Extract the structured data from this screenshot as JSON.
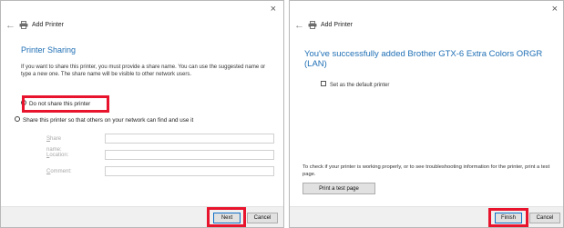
{
  "wizard1": {
    "close_glyph": "×",
    "back_glyph": "←",
    "header_title": "Add Printer",
    "page_title": "Printer Sharing",
    "description": "If you want to share this printer, you must provide a share name. You can use the suggested name or type a new one. The share name will be visible to other network users.",
    "options": [
      {
        "label": "Do not share this printer",
        "selected": true
      },
      {
        "label": "Share this printer so that others on your network can find and use it",
        "selected": false
      }
    ],
    "fields": [
      {
        "label": "Share name:",
        "value": ""
      },
      {
        "label": "Location:",
        "value": ""
      },
      {
        "label": "Comment:",
        "value": ""
      }
    ],
    "buttons": {
      "next": "Next",
      "cancel": "Cancel"
    }
  },
  "wizard2": {
    "close_glyph": "×",
    "back_glyph": "←",
    "header_title": "Add Printer",
    "success_message": "You've successfully added Brother GTX-6 Extra Colors ORGR (LAN)",
    "default_checkbox": {
      "label": "Set as the default printer",
      "checked": false
    },
    "info_text": "To check if your printer is working properly, or to see troubleshooting information for the printer, print a test page.",
    "print_test_button": "Print a test page",
    "buttons": {
      "finish": "Finish",
      "cancel": "Cancel"
    }
  },
  "colors": {
    "heading_blue": "#1f6fb5",
    "highlight_red": "#e8142d",
    "primary_button_border": "#0f6fc6"
  }
}
